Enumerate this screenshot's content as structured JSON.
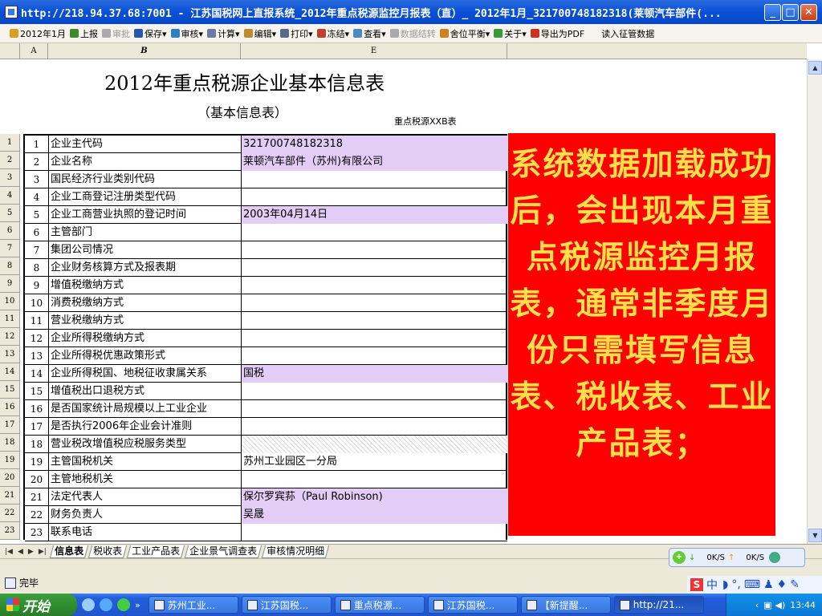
{
  "window": {
    "title": "http://218.94.37.68:7001 - 江苏国税网上直报系统_2012年重点税源监控月报表（直）_ 2012年1月_321700748182318(莱顿汽车部件(...",
    "min": "_",
    "max": "□",
    "close": "✕"
  },
  "toolbar": {
    "items": [
      {
        "label": "2012年1月",
        "icon": "calendar-icon",
        "color": "#d9a020",
        "enabled": true
      },
      {
        "label": "上报",
        "icon": "upload-icon",
        "color": "#3c8a2c",
        "enabled": true
      },
      {
        "label": "审批",
        "icon": "approve-icon",
        "color": "#aaaaaa",
        "enabled": false
      },
      {
        "label": "保存▾",
        "icon": "save-icon",
        "color": "#2a56b0",
        "enabled": true
      },
      {
        "label": "审核▾",
        "icon": "audit-icon",
        "color": "#2a80c0",
        "enabled": true
      },
      {
        "label": "计算▾",
        "icon": "calc-icon",
        "color": "#6a7aa0",
        "enabled": true
      },
      {
        "label": "编辑▾",
        "icon": "edit-icon",
        "color": "#c08a30",
        "enabled": true
      },
      {
        "label": "打印▾",
        "icon": "print-icon",
        "color": "#5a6a8a",
        "enabled": true
      },
      {
        "label": "冻结▾",
        "icon": "freeze-icon",
        "color": "#c04030",
        "enabled": true
      },
      {
        "label": "查看▾",
        "icon": "view-icon",
        "color": "#4a8ac0",
        "enabled": true
      },
      {
        "label": "数据结转",
        "icon": "carry-icon",
        "color": "#aaaaaa",
        "enabled": false
      },
      {
        "label": "舍位平衡▾",
        "icon": "balance-icon",
        "color": "#d08020",
        "enabled": true
      },
      {
        "label": "关于▾",
        "icon": "about-icon",
        "color": "#3a9a3a",
        "enabled": true
      },
      {
        "label": "导出为PDF",
        "icon": "pdf-icon",
        "color": "#d03020",
        "enabled": true
      },
      {
        "label": "读入征管数据",
        "icon": "",
        "color": "",
        "enabled": true
      }
    ]
  },
  "columns": {
    "a": "A",
    "b": "B",
    "e": "E"
  },
  "sheet": {
    "title": "2012年重点税源企业基本信息表",
    "subtitle": "（基本信息表）",
    "code": "重点税源XXB表"
  },
  "rows": [
    {
      "r": "1",
      "n": "1",
      "name": "企业主代码",
      "value": "321700748182318",
      "style": "purple"
    },
    {
      "r": "2",
      "n": "2",
      "name": "企业名称",
      "value": "莱顿汽车部件（苏州)有限公司",
      "style": "purple"
    },
    {
      "r": "3",
      "n": "3",
      "name": "国民经济行业类别代码",
      "value": "",
      "style": ""
    },
    {
      "r": "4",
      "n": "4",
      "name": "企业工商登记注册类型代码",
      "value": "",
      "style": ""
    },
    {
      "r": "5",
      "n": "5",
      "name": "企业工商营业执照的登记时间",
      "value": "2003年04月14日",
      "style": "purple"
    },
    {
      "r": "6",
      "n": "6",
      "name": "主管部门",
      "value": "",
      "style": ""
    },
    {
      "r": "7",
      "n": "7",
      "name": "集团公司情况",
      "value": "",
      "style": ""
    },
    {
      "r": "8",
      "n": "8",
      "name": "企业财务核算方式及报表期",
      "value": "",
      "style": ""
    },
    {
      "r": "9",
      "n": "9",
      "name": "增值税缴纳方式",
      "value": "",
      "style": ""
    },
    {
      "r": "10",
      "n": "10",
      "name": "消费税缴纳方式",
      "value": "",
      "style": ""
    },
    {
      "r": "11",
      "n": "11",
      "name": "营业税缴纳方式",
      "value": "",
      "style": ""
    },
    {
      "r": "12",
      "n": "12",
      "name": "企业所得税缴纳方式",
      "value": "",
      "style": ""
    },
    {
      "r": "13",
      "n": "13",
      "name": "企业所得税优惠政策形式",
      "value": "",
      "style": ""
    },
    {
      "r": "14",
      "n": "14",
      "name": "企业所得税国、地税征收隶属关系",
      "value": "国税",
      "style": "purple"
    },
    {
      "r": "15",
      "n": "15",
      "name": "增值税出口退税方式",
      "value": "",
      "style": ""
    },
    {
      "r": "16",
      "n": "16",
      "name": "是否国家统计局规模以上工业企业",
      "value": "",
      "style": ""
    },
    {
      "r": "17",
      "n": "17",
      "name": "是否执行2006年企业会计准则",
      "value": "",
      "style": ""
    },
    {
      "r": "18",
      "n": "18",
      "name": "营业税改增值税应税服务类型",
      "value": "",
      "style": "hatch"
    },
    {
      "r": "19",
      "n": "19",
      "name": "主管国税机关",
      "value": "苏州工业园区一分局",
      "style": ""
    },
    {
      "r": "20",
      "n": "20",
      "name": "主管地税机关",
      "value": "",
      "style": ""
    },
    {
      "r": "21",
      "n": "21",
      "name": "法定代表人",
      "value": "保尔罗宾荪（Paul Robinson)",
      "style": "purple"
    },
    {
      "r": "22",
      "n": "22",
      "name": "财务负责人",
      "value": "吴晟",
      "style": "purple"
    },
    {
      "r": "23",
      "n": "23",
      "name": "联系电话",
      "value": "",
      "style": ""
    }
  ],
  "annotation": {
    "text": "系统数据加载成功后，会出现本月重点税源监控月报表，通常非季度月份只需填写信息表、税收表、工业产品表；",
    "bg": "#ff0000",
    "fg": "#ffe04a"
  },
  "tabs": {
    "nav": [
      "|◀",
      "◀",
      "▶",
      "▶|"
    ],
    "items": [
      "信息表",
      "税收表",
      "工业产品表",
      "企业景气调查表",
      "审核情况明细"
    ],
    "active": 0
  },
  "netmon": {
    "down": "0K/S",
    "up": "0K/S"
  },
  "status": {
    "text": "完毕"
  },
  "ime": {
    "lang": "中"
  },
  "taskbar": {
    "start": "开始",
    "buttons": [
      "苏州工业...",
      "江苏国税...",
      "重点税源...",
      "江苏国税...",
      "【新提醒...",
      "http://21..."
    ],
    "active": 5,
    "clock": "13:44"
  }
}
